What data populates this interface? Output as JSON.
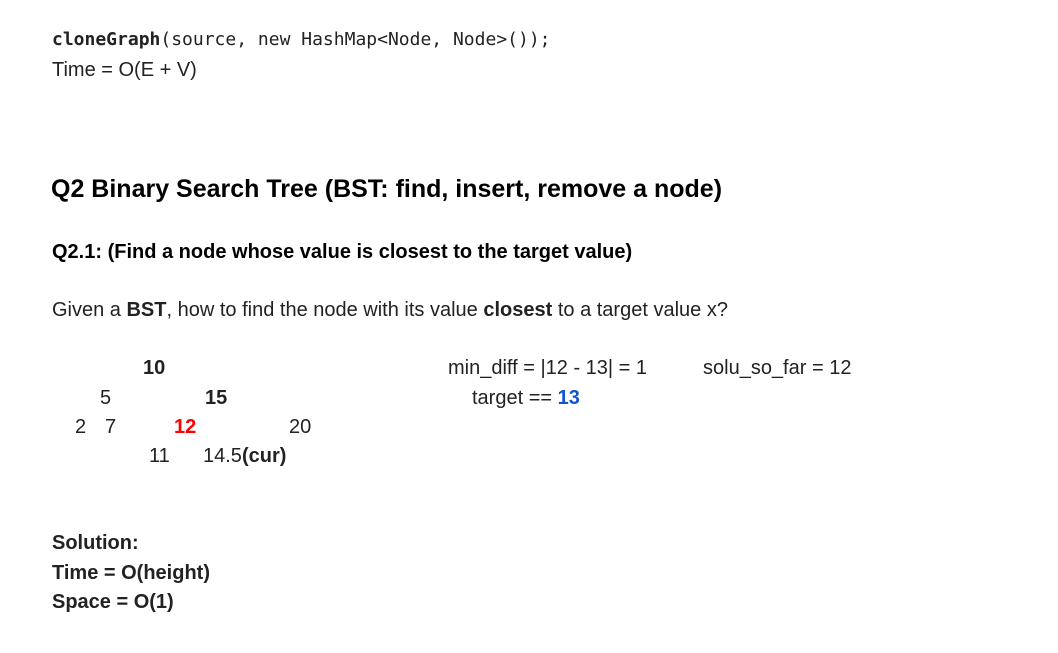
{
  "code_line": {
    "fn": "cloneGraph",
    "rest": "(source, new HashMap<Node, Node>());"
  },
  "time_line": "Time = O(E + V)",
  "heading": "Q2 Binary Search Tree (BST: find, insert, remove a node)",
  "subheading": "Q2.1: (Find a node whose value is closest to the target value)",
  "question": {
    "p1": "Given a ",
    "b1": "BST",
    "p2": ", how to find the node with its value ",
    "b2": "closest",
    "p3": " to a target value x?"
  },
  "tree": {
    "n10": "10",
    "n5": "5",
    "n15": "15",
    "n2": "2",
    "n7": "7",
    "n12": "12",
    "n20": "20",
    "n11": "11",
    "n14_5": "14.5",
    "cur": "(cur)"
  },
  "notes": {
    "min_diff": "min_diff = |12 - 13| = 1",
    "solu": "solu_so_far = 12",
    "target_label": "target == ",
    "target_value": "13"
  },
  "solution": {
    "title": "Solution:",
    "time": "Time = O(height)",
    "space": "Space = O(1)"
  },
  "colors": {
    "highlight_red": "#ff0000",
    "highlight_blue": "#1155cc"
  }
}
